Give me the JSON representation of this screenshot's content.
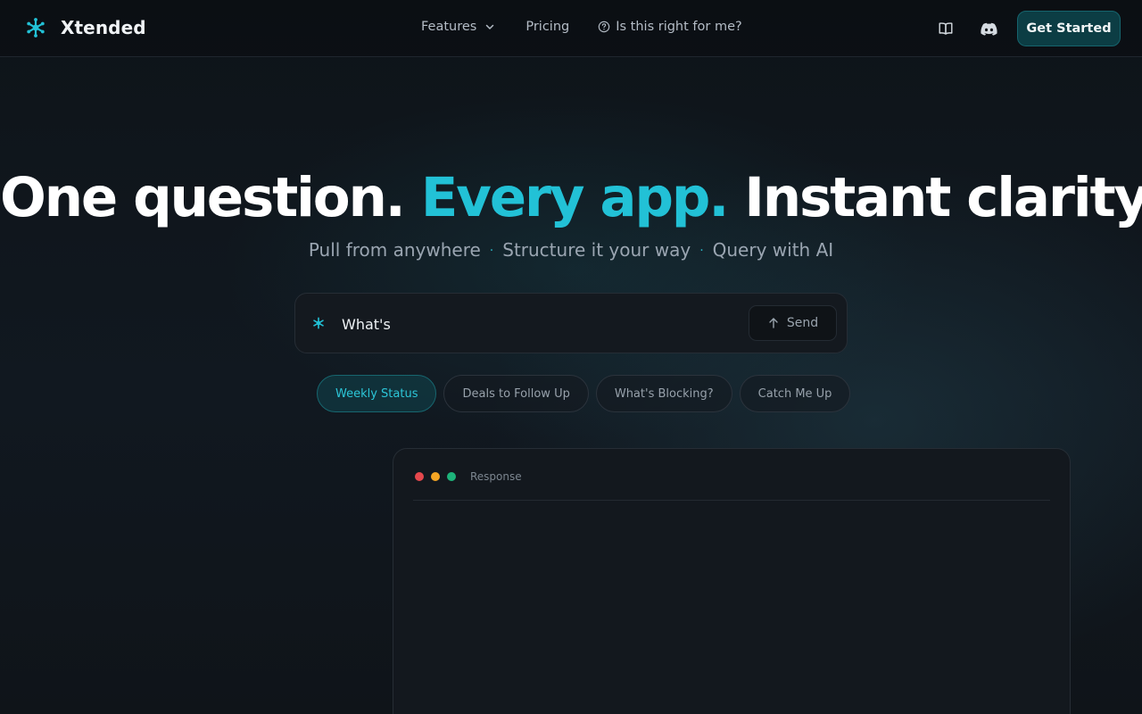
{
  "brand": {
    "name": "Xtended",
    "logo": "asterisk-logo-icon"
  },
  "nav": {
    "features": "Features",
    "pricing": "Pricing",
    "right_for_me": "Is this right for me?",
    "docs_icon": "book-open-icon",
    "discord_icon": "discord-icon",
    "cta": "Get Started"
  },
  "hero": {
    "title_lead": "One question. ",
    "title_accent": "Every app.",
    "title_tail": " Instant clarity.",
    "sub_1": "Pull from anywhere",
    "sub_2": "Structure it your way",
    "sub_3": "Query with AI",
    "separator": "·"
  },
  "ask": {
    "value": "What's",
    "send": "Send"
  },
  "chips": [
    "Weekly Status",
    "Deals to Follow Up",
    "What's Blocking?",
    "Catch Me Up"
  ],
  "panel": {
    "label": "Response"
  },
  "colors": {
    "accent": "#22c1d6",
    "cta_bg": "#0c3d44",
    "traffic_red": "#e5484d",
    "traffic_yellow": "#f5a524",
    "traffic_green": "#1db37a"
  }
}
